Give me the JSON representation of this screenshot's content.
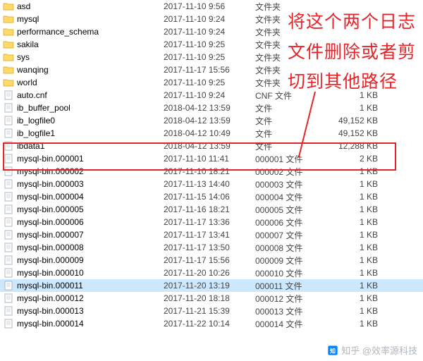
{
  "annotation": {
    "line1": "将这个两个日志",
    "line2": "文件删除或者剪",
    "line3": "切到其他路径"
  },
  "watermark": "知乎 @效率源科技",
  "files": [
    {
      "name": "asd",
      "date": "2017-11-10 9:56",
      "type": "文件夹",
      "size": "",
      "kind": "folder"
    },
    {
      "name": "mysql",
      "date": "2017-11-10 9:24",
      "type": "文件夹",
      "size": "",
      "kind": "folder"
    },
    {
      "name": "performance_schema",
      "date": "2017-11-10 9:24",
      "type": "文件夹",
      "size": "",
      "kind": "folder"
    },
    {
      "name": "sakila",
      "date": "2017-11-10 9:25",
      "type": "文件夹",
      "size": "",
      "kind": "folder"
    },
    {
      "name": "sys",
      "date": "2017-11-10 9:25",
      "type": "文件夹",
      "size": "",
      "kind": "folder"
    },
    {
      "name": "wanqing",
      "date": "2017-11-17 15:56",
      "type": "文件夹",
      "size": "",
      "kind": "folder"
    },
    {
      "name": "world",
      "date": "2017-11-10 9:25",
      "type": "文件夹",
      "size": "",
      "kind": "folder"
    },
    {
      "name": "auto.cnf",
      "date": "2017-11-10 9:24",
      "type": "CNF 文件",
      "size": "1 KB",
      "kind": "file"
    },
    {
      "name": "ib_buffer_pool",
      "date": "2018-04-12 13:59",
      "type": "文件",
      "size": "1 KB",
      "kind": "file"
    },
    {
      "name": "ib_logfile0",
      "date": "2018-04-12 13:59",
      "type": "文件",
      "size": "49,152 KB",
      "kind": "file"
    },
    {
      "name": "ib_logfile1",
      "date": "2018-04-12 10:49",
      "type": "文件",
      "size": "49,152 KB",
      "kind": "file"
    },
    {
      "name": "ibdata1",
      "date": "2018-04-12 13:59",
      "type": "文件",
      "size": "12,288 KB",
      "kind": "file"
    },
    {
      "name": "mysql-bin.000001",
      "date": "2017-11-10 11:41",
      "type": "000001 文件",
      "size": "2 KB",
      "kind": "file"
    },
    {
      "name": "mysql-bin.000002",
      "date": "2017-11-10 18:21",
      "type": "000002 文件",
      "size": "1 KB",
      "kind": "file"
    },
    {
      "name": "mysql-bin.000003",
      "date": "2017-11-13 14:40",
      "type": "000003 文件",
      "size": "1 KB",
      "kind": "file"
    },
    {
      "name": "mysql-bin.000004",
      "date": "2017-11-15 14:06",
      "type": "000004 文件",
      "size": "1 KB",
      "kind": "file"
    },
    {
      "name": "mysql-bin.000005",
      "date": "2017-11-16 18:21",
      "type": "000005 文件",
      "size": "1 KB",
      "kind": "file"
    },
    {
      "name": "mysql-bin.000006",
      "date": "2017-11-17 13:36",
      "type": "000006 文件",
      "size": "1 KB",
      "kind": "file"
    },
    {
      "name": "mysql-bin.000007",
      "date": "2017-11-17 13:41",
      "type": "000007 文件",
      "size": "1 KB",
      "kind": "file"
    },
    {
      "name": "mysql-bin.000008",
      "date": "2017-11-17 13:50",
      "type": "000008 文件",
      "size": "1 KB",
      "kind": "file"
    },
    {
      "name": "mysql-bin.000009",
      "date": "2017-11-17 15:56",
      "type": "000009 文件",
      "size": "1 KB",
      "kind": "file"
    },
    {
      "name": "mysql-bin.000010",
      "date": "2017-11-20 10:26",
      "type": "000010 文件",
      "size": "1 KB",
      "kind": "file"
    },
    {
      "name": "mysql-bin.000011",
      "date": "2017-11-20 13:19",
      "type": "000011 文件",
      "size": "1 KB",
      "kind": "file",
      "selected": true
    },
    {
      "name": "mysql-bin.000012",
      "date": "2017-11-20 18:18",
      "type": "000012 文件",
      "size": "1 KB",
      "kind": "file"
    },
    {
      "name": "mysql-bin.000013",
      "date": "2017-11-21 15:39",
      "type": "000013 文件",
      "size": "1 KB",
      "kind": "file"
    },
    {
      "name": "mysql-bin.000014",
      "date": "2017-11-22 10:14",
      "type": "000014 文件",
      "size": "1 KB",
      "kind": "file"
    }
  ]
}
